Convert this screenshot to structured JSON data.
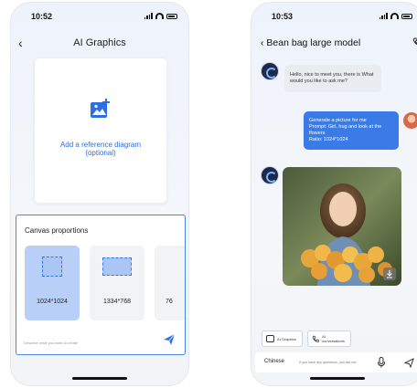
{
  "colors": {
    "accent": "#3a7be8",
    "selected_ratio": "#b8cff8",
    "panel_border": "#4a86e8"
  },
  "screen1": {
    "status_time": "10:52",
    "title": "AI Graphics",
    "reference": {
      "icon": "image-add-icon",
      "label_line1": "Add a reference diagram",
      "label_line2": "(optional)"
    },
    "canvas": {
      "title": "Canvas proportions",
      "ratios": [
        {
          "label": "1024*1024",
          "selected": true
        },
        {
          "label": "1334*768",
          "selected": false
        },
        {
          "label": "76",
          "selected": false
        }
      ],
      "prompt_placeholder": "Describe what you want to create",
      "send_icon": "send-icon"
    }
  },
  "screen2": {
    "status_time": "10:53",
    "title": "Bean bag large model",
    "bot_message": "Hello, nice to meet you, there is What would you like to ask me?",
    "user_message": {
      "line1": "Generate a picture for me",
      "line2": "Prompt: Girl, hug and look at the flowers",
      "line3": "Ratio: 1024*1024"
    },
    "chips": [
      {
        "label": "AI Graphics",
        "icon": "image-icon"
      },
      {
        "label": "AI conversations",
        "icon": "phone-icon"
      }
    ],
    "input": {
      "language": "Chinese",
      "placeholder": "If you have any questions, just ask me"
    }
  }
}
